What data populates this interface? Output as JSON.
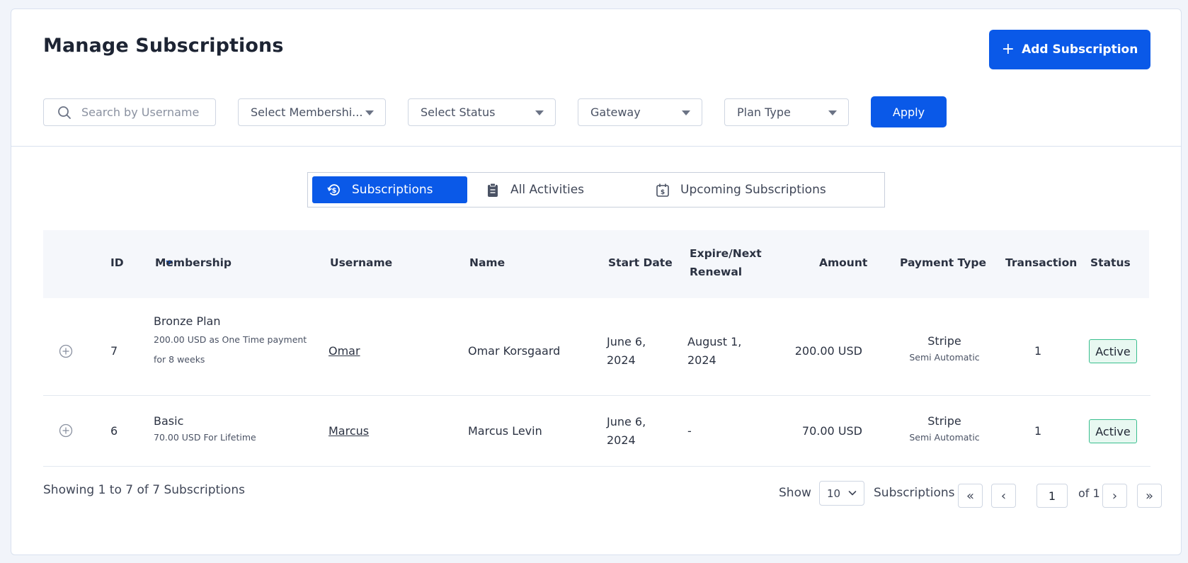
{
  "header": {
    "title": "Manage Subscriptions",
    "add_button": "Add Subscription"
  },
  "filters": {
    "search_placeholder": "Search by Username",
    "membership": "Select Membershi...",
    "status": "Select Status",
    "gateway": "Gateway",
    "plan_type": "Plan Type",
    "apply": "Apply"
  },
  "tabs": [
    {
      "label": "Subscriptions",
      "active": true
    },
    {
      "label": "All Activities",
      "active": false
    },
    {
      "label": "Upcoming Subscriptions",
      "active": false
    }
  ],
  "table": {
    "columns": {
      "id": "ID",
      "membership": "Membership",
      "username": "Username",
      "name": "Name",
      "start_date": "Start Date",
      "expire_1": "Expire/Next",
      "expire_2": "Renewal",
      "amount": "Amount",
      "payment_type": "Payment Type",
      "transaction": "Transaction",
      "status": "Status"
    },
    "rows": [
      {
        "id": "7",
        "plan": "Bronze Plan",
        "plan_desc_1": "200.00 USD as One Time payment",
        "plan_desc_2": "for 8 weeks",
        "username": "Omar",
        "name": "Omar Korsgaard",
        "start_1": "June 6,",
        "start_2": "2024",
        "expire_1": "August 1,",
        "expire_2": "2024",
        "amount": "200.00 USD",
        "gateway": "Stripe",
        "gateway_mode": "Semi Automatic",
        "transaction": "1",
        "status": "Active"
      },
      {
        "id": "6",
        "plan": "Basic",
        "plan_desc_1": "70.00 USD For Lifetime",
        "username": "Marcus",
        "name": "Marcus Levin",
        "start_1": "June 6,",
        "start_2": "2024",
        "expire_1": "-",
        "amount": "70.00 USD",
        "gateway": "Stripe",
        "gateway_mode": "Semi Automatic",
        "transaction": "1",
        "status": "Active"
      }
    ]
  },
  "footer": {
    "showing": "Showing 1 to 7 of 7 Subscriptions",
    "show_label": "Show",
    "page_size": "10",
    "subscriptions_label": "Subscriptions",
    "first": "«",
    "prev": "‹",
    "current_page": "1",
    "of_label": "of 1",
    "next": "›",
    "last": "»"
  },
  "colors": {
    "primary": "#0a59e8",
    "active_badge_border": "#39bf8e",
    "active_badge_bg": "#e8f8f1"
  }
}
